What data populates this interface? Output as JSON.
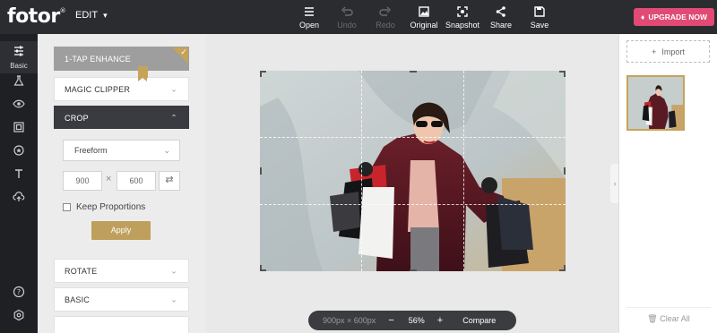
{
  "app": {
    "logo": "fotor",
    "logo_mark": "®",
    "edit_menu": "EDIT"
  },
  "toolbar": [
    {
      "label": "Open",
      "icon": "menu-icon",
      "enabled": true
    },
    {
      "label": "Undo",
      "icon": "undo-icon",
      "enabled": false
    },
    {
      "label": "Redo",
      "icon": "redo-icon",
      "enabled": false
    },
    {
      "label": "Original",
      "icon": "image-icon",
      "enabled": true
    },
    {
      "label": "Snapshot",
      "icon": "snapshot-icon",
      "enabled": true
    },
    {
      "label": "Share",
      "icon": "share-icon",
      "enabled": true
    },
    {
      "label": "Save",
      "icon": "save-icon",
      "enabled": true
    }
  ],
  "upgrade": {
    "label": "UPGRADE NOW",
    "color": "#e04a74"
  },
  "rail": {
    "active_label": "Basic",
    "items": [
      "sliders-icon",
      "flask-icon",
      "eye-icon",
      "frame-icon",
      "sticker-icon",
      "text-icon",
      "cloud-upload-icon",
      "help-icon",
      "settings-icon"
    ]
  },
  "panel": {
    "enhance": "1-TAP ENHANCE",
    "magic_clipper": "MAGIC CLIPPER",
    "crop": "CROP",
    "crop_mode": "Freeform",
    "width": "900",
    "height": "600",
    "times": "×",
    "keep_proportions": "Keep Proportions",
    "apply": "Apply",
    "rotate": "ROTATE",
    "basic": "BASIC"
  },
  "canvas": {
    "image_size": "900px × 600px",
    "zoom_out": "−",
    "zoom": "56%",
    "zoom_in": "+",
    "compare": "Compare"
  },
  "right_panel": {
    "import": "Import",
    "clear_all": "Clear All"
  },
  "colors": {
    "accent_gold": "#c5a35a",
    "topbar": "#2b2c30",
    "rail": "#1f2024"
  }
}
